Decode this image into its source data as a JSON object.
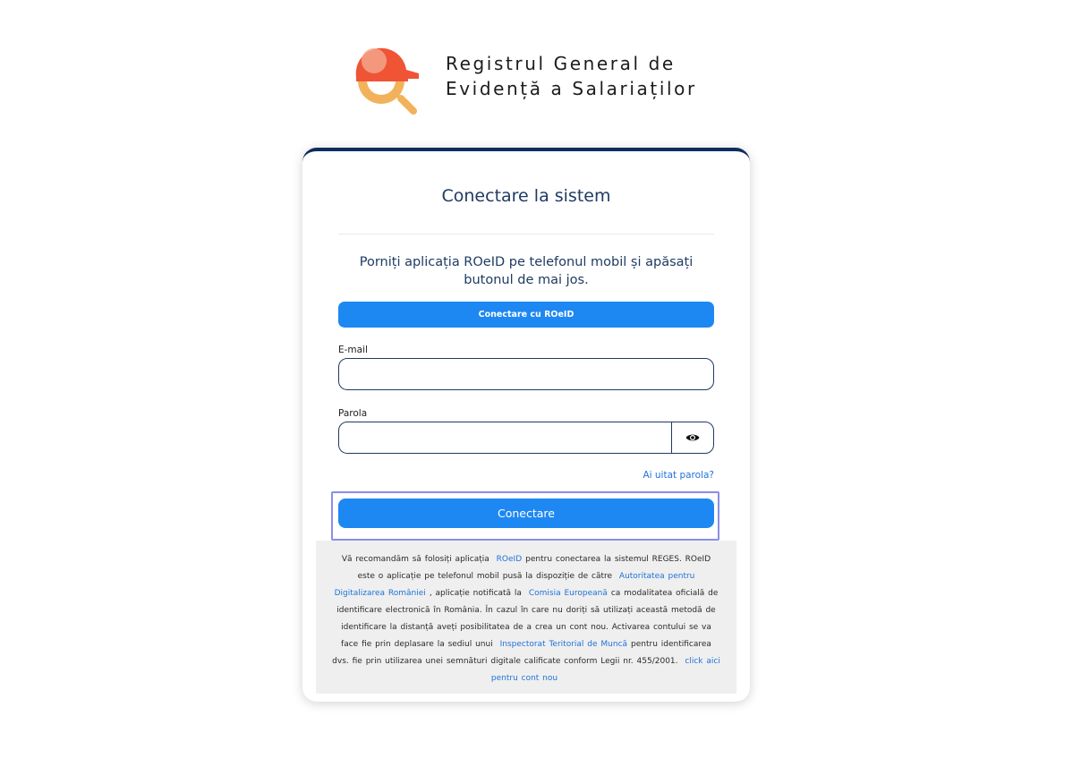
{
  "brand": {
    "title_line1": "Registrul General de",
    "title_line2": "Evidență a Salariaților",
    "logo_icon": "helmet-magnifier-icon",
    "colors": {
      "helmet": "#ef5535",
      "helmet_light": "#f4a48a",
      "magnifier": "#f2b25b"
    }
  },
  "login": {
    "title": "Conectare la sistem",
    "instructions": "Porniți aplicația ROeID pe telefonul mobil și apăsați butonul de mai jos.",
    "roeid_button": "Conectare cu ROeID",
    "email_label": "E-mail",
    "email_value": "",
    "password_label": "Parola",
    "password_value": "",
    "show_password_icon": "eye-icon",
    "forgot_password": "Ai uitat parola?",
    "submit_button": "Conectare"
  },
  "info": {
    "t1": "Vă recomandăm să folosiți aplicația",
    "link_roeid": "ROeID",
    "t2": "pentru conectarea la sistemul REGES. ROeID este o aplicație pe telefonul mobil pusă la dispoziție de către",
    "link_adr": "Autoritatea pentru Digitalizarea României",
    "t3": ", aplicație notificată la",
    "link_ce": "Comisia Europeană",
    "t4": "ca modalitatea oficială de identificare electronică în România. În cazul în care nu doriți să utilizați această metodă de identificare la distanță aveți posibilitatea de a crea un cont nou. Activarea contului se va face fie prin deplasare la sediul unui",
    "link_itm": "Inspectorat Teritorial de Muncă",
    "t5": "pentru identificarea dvs. fie prin utilizarea unei semnături digitale calificate conform Legii nr. 455/2001.",
    "link_new": "click aici pentru cont nou"
  },
  "colors": {
    "accent": "#1e88f2",
    "navy": "#1f3b63",
    "card_top": "#0d2d5e",
    "link": "#1e72d8",
    "focus": "#8a8ee8"
  }
}
